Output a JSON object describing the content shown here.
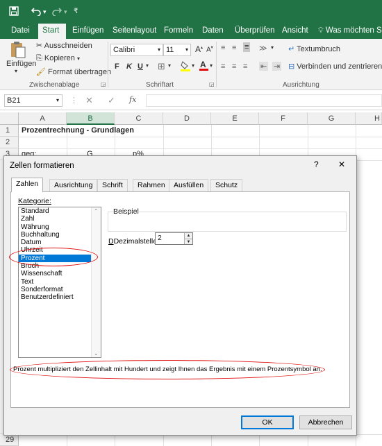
{
  "quick_access": {
    "save_icon": "save-icon",
    "undo_icon": "undo-icon",
    "redo_icon": "redo-icon",
    "customize_icon": "customize-icon"
  },
  "ribbon_tabs": [
    "Datei",
    "Start",
    "Einfügen",
    "Seitenlayout",
    "Formeln",
    "Daten",
    "Überprüfen",
    "Ansicht",
    "Was möchten Sie"
  ],
  "active_tab": "Start",
  "clipboard": {
    "paste": "Einfügen",
    "cut": "Ausschneiden",
    "copy": "Kopieren",
    "format_painter": "Format übertragen",
    "group_label": "Zwischenablage"
  },
  "font": {
    "name": "Calibri",
    "size": "11",
    "grow": "A",
    "shrink": "A",
    "bold": "F",
    "italic": "K",
    "underline": "U",
    "group_label": "Schriftart"
  },
  "alignment": {
    "wrap_text": "Textumbruch",
    "merge_center": "Verbinden und zentrieren",
    "group_label": "Ausrichtung"
  },
  "formula_bar": {
    "name_box": "B21",
    "fx": "fx",
    "formula": ""
  },
  "columns": [
    "A",
    "B",
    "C",
    "D",
    "E",
    "F",
    "G",
    "H"
  ],
  "selected_column": "B",
  "rows": [
    {
      "num": "1",
      "A": "Prozentrechnung - Grundlagen",
      "B": "",
      "C": ""
    },
    {
      "num": "2",
      "A": "",
      "B": "",
      "C": ""
    },
    {
      "num": "3",
      "A": "geg:",
      "B": "G",
      "C": "p%"
    }
  ],
  "last_row_num": "29",
  "dialog": {
    "title": "Zellen formatieren",
    "help": "?",
    "close": "✕",
    "tabs": [
      "Zahlen",
      "Ausrichtung",
      "Schrift",
      "Rahmen",
      "Ausfüllen",
      "Schutz"
    ],
    "active_tab": "Zahlen",
    "category_label": "Kategorie:",
    "categories": [
      "Standard",
      "Zahl",
      "Währung",
      "Buchhaltung",
      "Datum",
      "Uhrzeit",
      "Prozent",
      "Bruch",
      "Wissenschaft",
      "Text",
      "Sonderformat",
      "Benutzerdefiniert"
    ],
    "selected_category": "Prozent",
    "sample_label": "Beispiel",
    "decimal_label": "Dezimalstellen:",
    "decimal_value": "2",
    "description": "Prozent multipliziert den Zellinhalt mit Hundert und zeigt Ihnen das Ergebnis mit einem Prozentsymbol an.",
    "ok": "OK",
    "cancel": "Abbrechen"
  },
  "colors": {
    "excel_green": "#217346",
    "selection_blue": "#0078d7",
    "annotation_red": "#e01010"
  }
}
